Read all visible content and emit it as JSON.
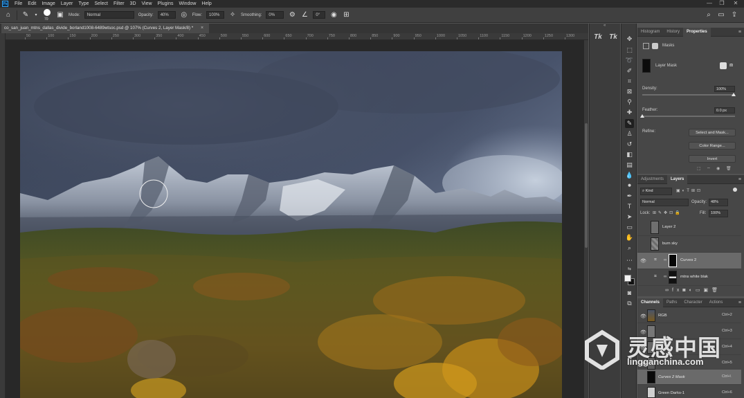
{
  "app": {
    "logo": "Ps",
    "menu": [
      "File",
      "Edit",
      "Image",
      "Layer",
      "Type",
      "Select",
      "Filter",
      "3D",
      "View",
      "Plugins",
      "Window",
      "Help"
    ],
    "window_controls": [
      "—",
      "❐",
      "✕"
    ]
  },
  "options": {
    "brush_size": "70",
    "mode_label": "Mode:",
    "mode_value": "Normal",
    "opacity_label": "Opacity:",
    "opacity_value": "40%",
    "flow_label": "Flow:",
    "flow_value": "100%",
    "smoothing_label": "Smoothing:",
    "smoothing_value": "0%",
    "angle_value": "0°"
  },
  "document": {
    "tab_title": "co_san_juan_mtns_dallas_divide_borland1008-6489wtsoc.psd @ 107% (Curves 2, Layer Mask/8) *",
    "close": "×"
  },
  "ruler": {
    "labels": [
      "50",
      "100",
      "150",
      "200",
      "250",
      "300",
      "350",
      "400",
      "450",
      "500",
      "550",
      "600",
      "650",
      "700",
      "750",
      "800",
      "850",
      "900",
      "950",
      "1000",
      "1050",
      "1100",
      "1150",
      "1200",
      "1250",
      "1300"
    ]
  },
  "strip": {
    "tk1": "Tk",
    "tk2": "Tk"
  },
  "properties": {
    "tabs": [
      "Histogram",
      "History",
      "Properties"
    ],
    "active_tab": "Properties",
    "masks_label": "Masks",
    "layer_mask_label": "Layer Mask",
    "density_label": "Density:",
    "density_value": "100%",
    "density_level": 1.0,
    "feather_label": "Feather:",
    "feather_value": "0.0 px",
    "feather_level": 0.0,
    "refine_label": "Refine:",
    "btn_select_mask": "Select and Mask...",
    "btn_color_range": "Color Range...",
    "btn_invert": "Invert"
  },
  "layers": {
    "tabs": [
      "Adjustments",
      "Layers"
    ],
    "active_tab": "Layers",
    "kind_label": "Kind",
    "blend_mode": "Normal",
    "opacity_label": "Opacity:",
    "opacity_value": "48%",
    "lock_label": "Lock:",
    "fill_label": "Fill:",
    "fill_value": "100%",
    "items": [
      {
        "name": "Layer 2",
        "visible": false,
        "selected": false
      },
      {
        "name": "burn sky",
        "visible": false,
        "selected": false
      },
      {
        "name": "Curves 2",
        "visible": true,
        "selected": true
      },
      {
        "name": "mtns white blak",
        "visible": false,
        "selected": false
      }
    ]
  },
  "channels": {
    "tabs": [
      "Channels",
      "Paths",
      "Character",
      "Actions"
    ],
    "active_tab": "Channels",
    "items": [
      {
        "name": "RGB",
        "shortcut": "Ctrl+2",
        "selected": false
      },
      {
        "name": "",
        "shortcut": "Ctrl+3",
        "selected": false
      },
      {
        "name": "",
        "shortcut": "Ctrl+4",
        "selected": false
      },
      {
        "name": "",
        "shortcut": "Ctrl+5",
        "selected": false
      },
      {
        "name": "Curves 2 Mask",
        "shortcut": "Ctrl+\\",
        "selected": true
      },
      {
        "name": "Green Darks-1",
        "shortcut": "Ctrl+6",
        "selected": false
      }
    ]
  },
  "watermark": {
    "cn": "灵感中国",
    "en": "lingganchina.com"
  },
  "colors": {
    "accent": "#31a8ff",
    "panel_bg": "#474747",
    "selected_row": "#6a6a6a"
  }
}
